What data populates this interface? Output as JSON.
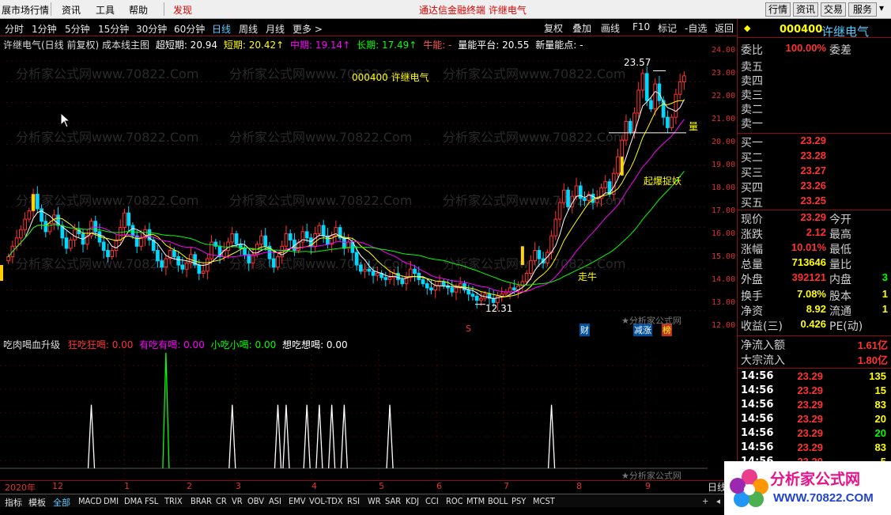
{
  "menu": {
    "items": [
      "展市场行情",
      "资讯",
      "工具",
      "帮助",
      "发现"
    ],
    "center_title": "通达信金融终端  许继电气",
    "right_buttons": [
      "行情",
      "资讯",
      "交易",
      "服务"
    ]
  },
  "toolbar": {
    "periods": [
      "分时",
      "1分钟",
      "5分钟",
      "15分钟",
      "30分钟",
      "60分钟",
      "日线",
      "周线",
      "月线",
      "更多 >"
    ],
    "active_period": "日线",
    "right": [
      "复权",
      "叠加",
      "画线",
      "F10",
      "标记",
      "-自选",
      "返回"
    ]
  },
  "indicator_bar": {
    "name": "许继电气(日线 前复权) 成本线主图",
    "items": [
      {
        "label": "超短期: 20.94",
        "color": "#ffffff"
      },
      {
        "label": "短期: 20.42↑",
        "color": "#ffff00"
      },
      {
        "label": "中期: 19.14↑",
        "color": "#ff00ff"
      },
      {
        "label": "长期: 17.49↑",
        "color": "#00ff00"
      },
      {
        "label": "牛能: -",
        "color": "#ff5555"
      },
      {
        "label": "量能平台: 20.55",
        "color": "#ffffff"
      },
      {
        "label": "新量能点: -",
        "color": "#ffffff"
      }
    ]
  },
  "chart_header": "000400 许继电气",
  "watermark": "分析家公式网www.70822.Com",
  "watermark_small": "★分析家公式网",
  "chart_data": {
    "type": "candlestick",
    "y_ticks": [
      "24.00",
      "23.00",
      "22.00",
      "21.00",
      "20.00",
      "19.00",
      "18.00",
      "17.00",
      "16.00",
      "15.00",
      "14.00",
      "13.00",
      "12.00"
    ],
    "ylim": [
      11.5,
      24.5
    ],
    "annotations": [
      "23.57",
      "12.31",
      "走牛",
      "起爆捉妖",
      "量",
      "财",
      "减涨",
      "榜",
      "S"
    ],
    "closes": [
      14.6,
      15.1,
      15.5,
      15.9,
      16.4,
      16.8,
      17.6,
      16.9,
      16.3,
      15.8,
      16.2,
      16.6,
      16.1,
      15.5,
      15.0,
      15.4,
      15.9,
      15.7,
      15.2,
      15.6,
      16.3,
      15.8,
      15.3,
      14.9,
      14.6,
      14.9,
      15.4,
      16.0,
      16.7,
      16.1,
      15.6,
      15.1,
      15.5,
      15.9,
      15.4,
      14.9,
      14.4,
      14.1,
      14.5,
      14.9,
      14.6,
      14.2,
      14.0,
      14.3,
      14.7,
      14.2,
      13.8,
      13.9,
      14.5,
      15.3,
      15.1,
      14.6,
      14.9,
      15.3,
      15.7,
      15.2,
      15.0,
      14.7,
      14.3,
      14.7,
      15.2,
      15.6,
      15.1,
      14.5,
      14.1,
      14.6,
      15.1,
      15.7,
      15.4,
      14.9,
      15.3,
      15.8,
      15.5,
      15.1,
      15.7,
      16.1,
      15.6,
      15.2,
      15.6,
      16.0,
      15.5,
      15.0,
      15.3,
      14.8,
      14.2,
      13.9,
      14.0,
      13.9,
      13.7,
      13.8,
      13.6,
      13.5,
      13.6,
      13.8,
      13.5,
      13.3,
      13.6,
      14.0,
      13.8,
      13.5,
      13.3,
      13.1,
      13.0,
      13.2,
      13.4,
      13.2,
      13.1,
      12.9,
      13.1,
      13.3,
      13.0,
      12.8,
      12.7,
      12.5,
      12.6,
      12.8,
      12.6,
      12.4,
      12.7,
      12.8,
      12.9,
      13.1,
      13.0,
      13.2,
      13.4,
      13.8,
      14.4,
      14.9,
      14.5,
      14.3,
      14.8,
      15.6,
      16.4,
      17.2,
      17.8,
      17.0,
      17.5,
      18.0,
      17.4,
      17.3,
      17.6,
      17.2,
      17.4,
      17.9,
      18.2,
      17.6,
      18.6,
      19.4,
      20.2,
      21.1,
      20.6,
      21.5,
      22.6,
      23.4,
      22.1,
      21.7,
      22.9,
      22.1,
      21.3,
      20.8,
      21.3,
      22.4,
      23.0,
      23.29
    ],
    "ma": [
      {
        "name": "超短期",
        "value": 20.94,
        "color": "#ffffff"
      },
      {
        "name": "短期",
        "value": 20.42,
        "color": "#ffff00"
      },
      {
        "name": "中期",
        "value": 19.14,
        "color": "#ff00ff"
      },
      {
        "name": "长期",
        "value": 17.49,
        "color": "#00ff00"
      }
    ]
  },
  "oscillator": {
    "title": "吃肉喝血升级",
    "items": [
      {
        "label": "狂吃狂喝: 0.00",
        "color": "#ff3333"
      },
      {
        "label": "有吃有喝: 0.00",
        "color": "#ff00ff"
      },
      {
        "label": "小吃小喝: 0.00",
        "color": "#00ff00"
      },
      {
        "label": "想吃想喝: 0.00",
        "color": "#ffffff"
      }
    ],
    "spikes": [
      {
        "bar": 20,
        "value": 0.55,
        "color": "#ffffff"
      },
      {
        "bar": 38,
        "value": 1.0,
        "color": "#00ff00"
      },
      {
        "bar": 54,
        "value": 0.55,
        "color": "#ffffff"
      },
      {
        "bar": 65,
        "value": 0.55,
        "color": "#ffffff"
      },
      {
        "bar": 67,
        "value": 0.55,
        "color": "#ffffff"
      },
      {
        "bar": 72,
        "value": 0.55,
        "color": "#ffffff"
      },
      {
        "bar": 75,
        "value": 0.55,
        "color": "#ffffff"
      },
      {
        "bar": 78,
        "value": 0.55,
        "color": "#ffffff"
      },
      {
        "bar": 81,
        "value": 0.55,
        "color": "#ffffff"
      },
      {
        "bar": 92,
        "value": 0.55,
        "color": "#ffffff"
      },
      {
        "bar": 131,
        "value": 0.55,
        "color": "#ffffff"
      }
    ]
  },
  "timeline": [
    "2020年",
    "12",
    "1",
    "2",
    "3",
    "4",
    "5",
    "6",
    "7",
    "8",
    "9"
  ],
  "bottom_tabs": [
    "指标",
    "模板",
    "全部",
    "MACD",
    "DMI",
    "DMA",
    "FSL",
    "TRIX",
    "BRAR",
    "CR",
    "VR",
    "OBV",
    "ASI",
    "EMV",
    "VOL-TDX",
    "RSI",
    "WR",
    "SAR",
    "KDJ",
    "CCI",
    "ROC",
    "MTM",
    "BOLL",
    "PSY",
    "MCST"
  ],
  "active_tab": "全部",
  "quote": {
    "code": "000400",
    "name": "许继电气",
    "weibi_label": "委比",
    "weibi": "100.00%",
    "weicha_label": "委差",
    "sells": [
      {
        "label": "卖五"
      },
      {
        "label": "卖四"
      },
      {
        "label": "卖三"
      },
      {
        "label": "卖二"
      },
      {
        "label": "卖一"
      }
    ],
    "buys": [
      {
        "label": "买一",
        "price": "23.29"
      },
      {
        "label": "买二",
        "price": "23.28"
      },
      {
        "label": "买三",
        "price": "23.27"
      },
      {
        "label": "买四",
        "price": "23.26"
      },
      {
        "label": "买五",
        "price": "23.25"
      }
    ],
    "stats": [
      {
        "l": "现价",
        "v": "23.29",
        "vc": "#ff3333",
        "l2": "今开",
        "v2": ""
      },
      {
        "l": "涨跌",
        "v": "2.12",
        "vc": "#ff3333",
        "l2": "最高",
        "v2": ""
      },
      {
        "l": "涨幅",
        "v": "10.01%",
        "vc": "#ff3333",
        "l2": "最低",
        "v2": ""
      },
      {
        "l": "总量",
        "v": "713646",
        "vc": "#ffff00",
        "l2": "量比",
        "v2": ""
      },
      {
        "l": "外盘",
        "v": "392121",
        "vc": "#ff3333",
        "l2": "内盘",
        "v2": "3"
      },
      {
        "l": "换手",
        "v": "7.08%",
        "vc": "#ffff00",
        "l2": "股本",
        "v2": "1"
      },
      {
        "l": "净资",
        "v": "8.92",
        "vc": "#ffff00",
        "l2": "流通",
        "v2": "1"
      },
      {
        "l": "收益(三)",
        "v": "0.426",
        "vc": "#ffff00",
        "l2": "PE(动)",
        "v2": ""
      }
    ],
    "flows": [
      {
        "l": "净流入额",
        "v": "1.61亿"
      },
      {
        "l": "大宗流入",
        "v": "1.80亿"
      }
    ],
    "ticks": [
      {
        "t": "14:56",
        "p": "23.29",
        "v": "135"
      },
      {
        "t": "14:56",
        "p": "23.29",
        "v": "15"
      },
      {
        "t": "14:56",
        "p": "23.29",
        "v": "83"
      },
      {
        "t": "14:56",
        "p": "23.29",
        "v": "20"
      },
      {
        "t": "14:56",
        "p": "23.29",
        "v": "20"
      },
      {
        "t": "14:56",
        "p": "23.29",
        "v": "83"
      },
      {
        "t": "14:56",
        "p": "23.29",
        "v": "5"
      }
    ]
  },
  "side_tab": "日线",
  "logo": {
    "text": "分析家公式网",
    "url": "WWW.70822.COM"
  }
}
